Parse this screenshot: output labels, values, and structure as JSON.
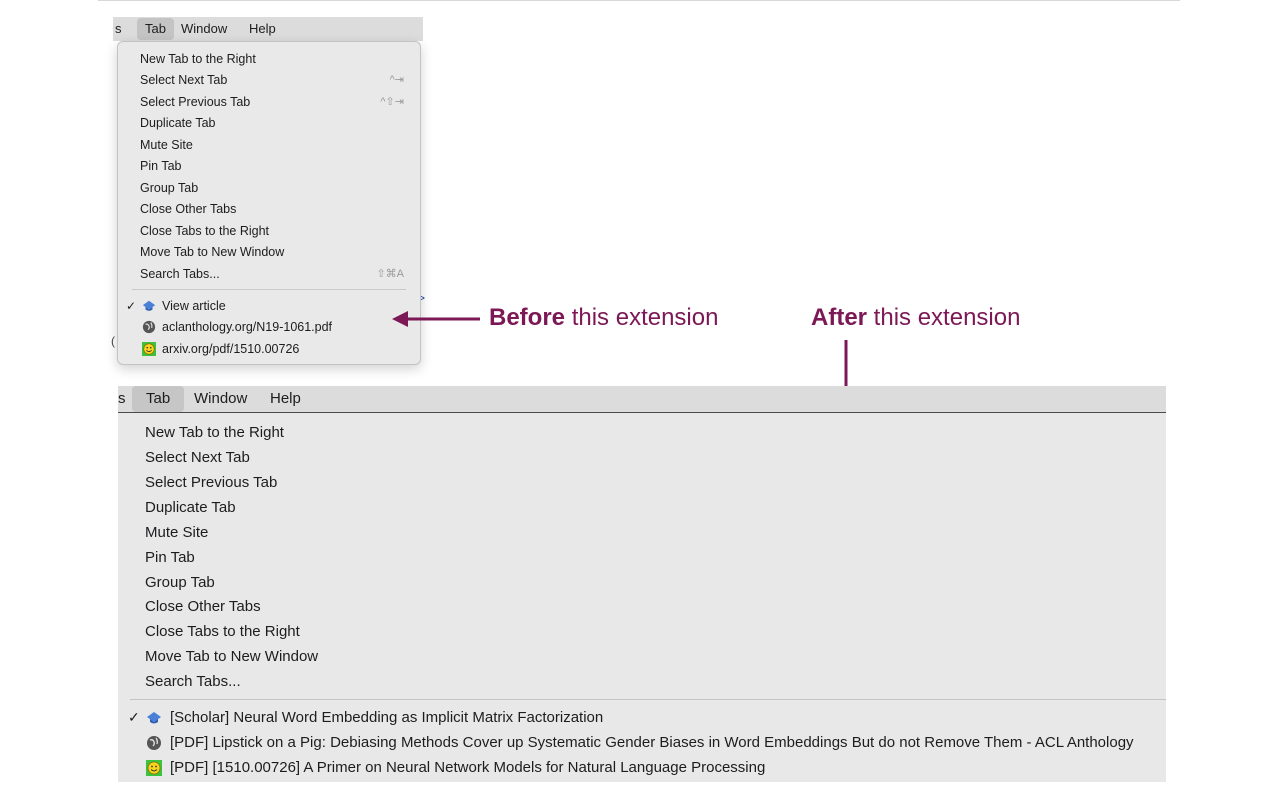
{
  "menubar": {
    "partial_left": "s",
    "items": [
      "Tab",
      "Window",
      "Help"
    ],
    "active": "Tab"
  },
  "tab_menu": {
    "items": [
      {
        "label": "New Tab to the Right",
        "shortcut": ""
      },
      {
        "label": "Select Next Tab",
        "shortcut": "^⇥"
      },
      {
        "label": "Select Previous Tab",
        "shortcut": "^⇧⇥"
      },
      {
        "label": "Duplicate Tab",
        "shortcut": ""
      },
      {
        "label": "Mute Site",
        "shortcut": ""
      },
      {
        "label": "Pin Tab",
        "shortcut": ""
      },
      {
        "label": "Group Tab",
        "shortcut": ""
      },
      {
        "label": "Close Other Tabs",
        "shortcut": ""
      },
      {
        "label": "Close Tabs to the Right",
        "shortcut": ""
      },
      {
        "label": "Move Tab to New Window",
        "shortcut": ""
      },
      {
        "label": "Search Tabs...",
        "shortcut": "⇧⌘A"
      }
    ]
  },
  "before": {
    "tabs": [
      {
        "title": "View article",
        "icon": "scholar-cap-icon",
        "checked": true
      },
      {
        "title": "aclanthology.org/N19-1061.pdf",
        "icon": "globe-icon",
        "checked": false
      },
      {
        "title": "arxiv.org/pdf/1510.00726",
        "icon": "smiley-icon",
        "checked": false
      }
    ]
  },
  "after": {
    "tabs": [
      {
        "title": "[Scholar] Neural Word Embedding as Implicit Matrix Factorization",
        "icon": "scholar-cap-icon",
        "checked": true
      },
      {
        "title": "[PDF] Lipstick on a Pig: Debiasing Methods Cover up Systematic Gender Biases in Word Embeddings But do not Remove Them - ACL Anthology",
        "icon": "globe-icon",
        "checked": false
      },
      {
        "title": "[PDF] [1510.00726] A Primer on Neural Network Models for Natural Language Processing",
        "icon": "smiley-icon",
        "checked": false
      }
    ]
  },
  "check_mark": "✓",
  "annotations": {
    "before_bold": "Before",
    "before_rest": " this extension",
    "after_bold": "After",
    "after_rest": " this extension",
    "color": "#7b1855"
  }
}
